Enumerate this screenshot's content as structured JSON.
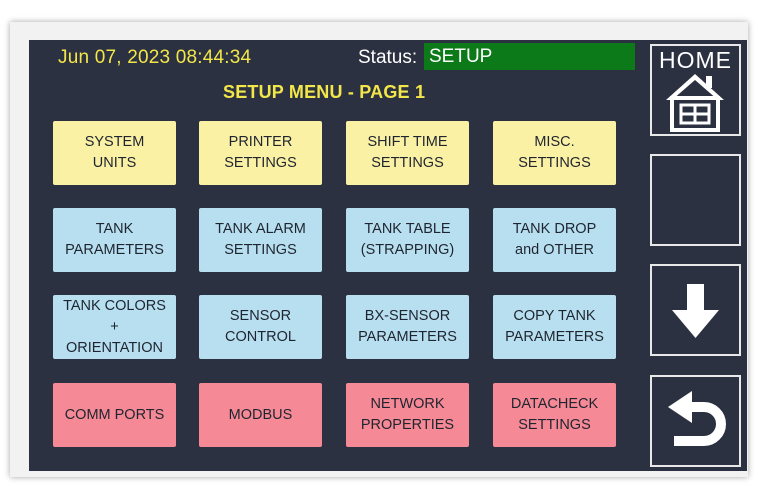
{
  "header": {
    "datetime": "Jun 07, 2023 08:44:34",
    "status_label": "Status:",
    "status_value": "SETUP"
  },
  "title": "SETUP MENU - PAGE 1",
  "colors": {
    "panel": "#2b3140",
    "header_text": "#f3e64a",
    "status_bg": "#0d7a1a",
    "yellow_button": "#fbf1a4",
    "blue_button": "#b7dff0",
    "red_button": "#f58995"
  },
  "menu": {
    "row1": [
      "SYSTEM\nUNITS",
      "PRINTER\nSETTINGS",
      "SHIFT TIME\nSETTINGS",
      "MISC.\nSETTINGS"
    ],
    "row2": [
      "TANK\nPARAMETERS",
      "TANK ALARM\nSETTINGS",
      "TANK TABLE\n(STRAPPING)",
      "TANK DROP\nand OTHER"
    ],
    "row3": [
      "TANK COLORS\n+\nORIENTATION",
      "SENSOR\nCONTROL",
      "BX-SENSOR\nPARAMETERS",
      "COPY TANK\nPARAMETERS"
    ],
    "row4": [
      "COMM PORTS",
      "MODBUS",
      "NETWORK\nPROPERTIES",
      "DATACHECK\nSETTINGS"
    ]
  },
  "sidebar": {
    "home_label": "HOME",
    "home_icon": "house-icon",
    "down_icon": "arrow-down-icon",
    "back_icon": "return-arrow-icon"
  }
}
